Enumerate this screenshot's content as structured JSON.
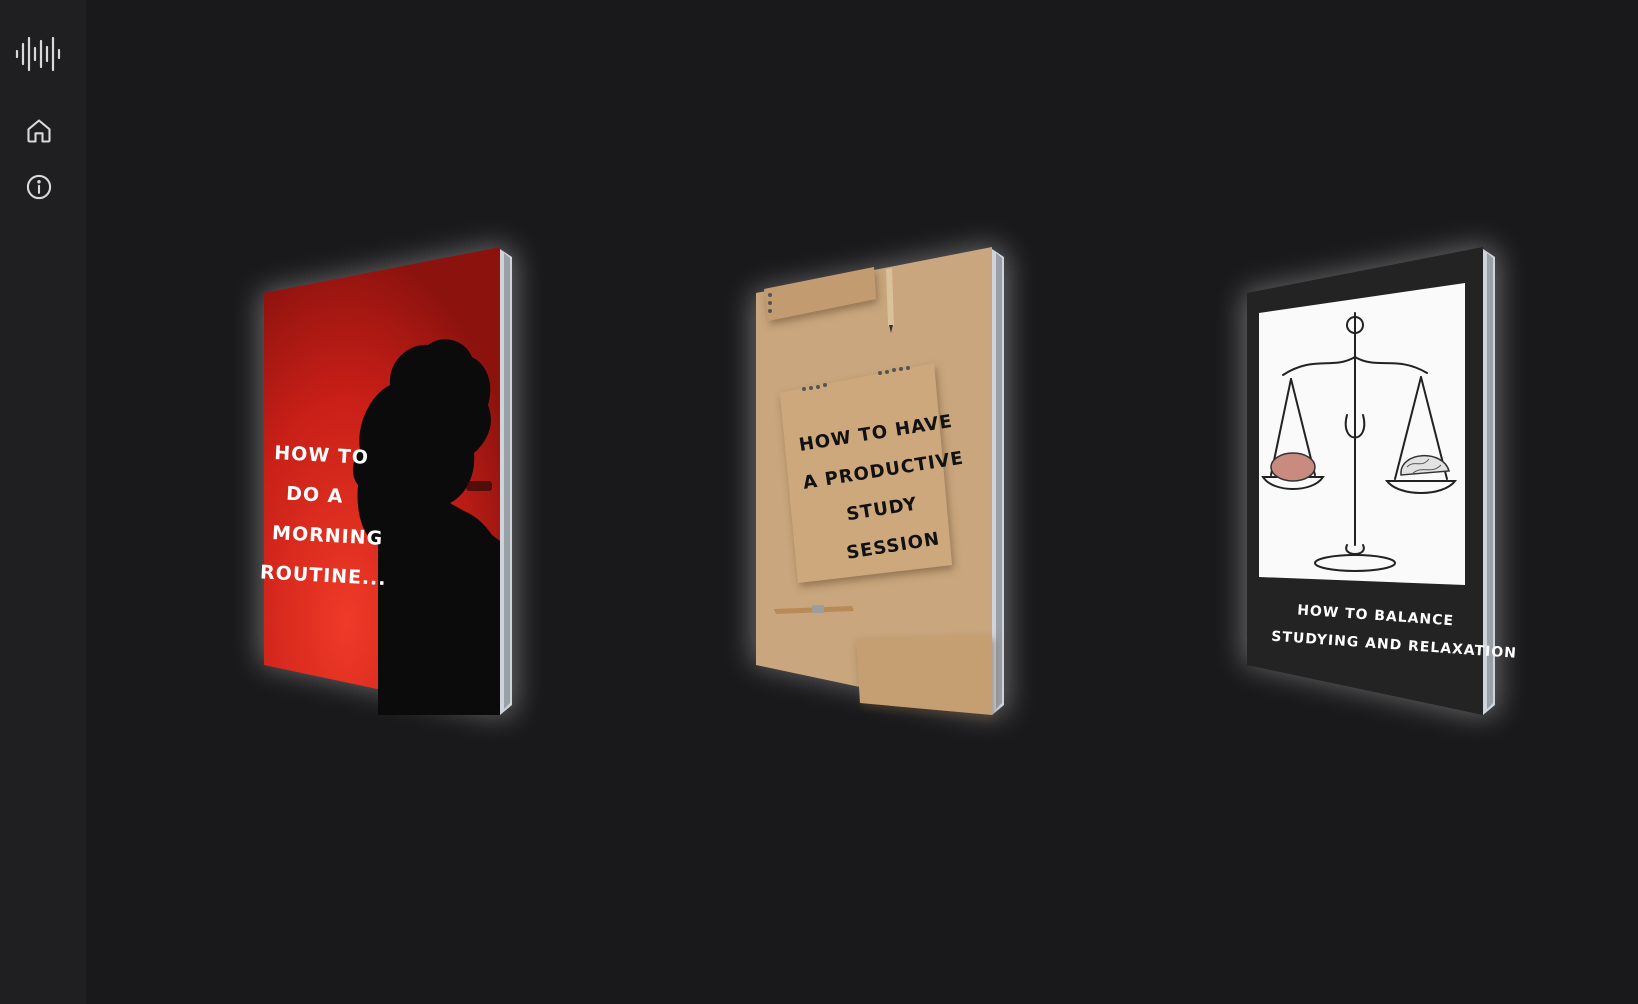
{
  "sidebar": {
    "logo_icon": "soundwave-logo-icon",
    "nav": [
      {
        "icon": "home-icon"
      },
      {
        "icon": "info-icon"
      }
    ]
  },
  "books": [
    {
      "cover_lines": [
        "HOW TO",
        "DO A",
        "MORNING",
        "ROUTINE..."
      ],
      "cover_color": "#d8221b"
    },
    {
      "cover_lines": [
        "HOW TO HAVE",
        "A PRODUCTIVE",
        "STUDY",
        "SESSION"
      ],
      "cover_color": "#c8a57c"
    },
    {
      "cover_lines": [
        "HOW TO BALANCE",
        "STUDYING AND RELAXATION"
      ],
      "cover_color": "#222222"
    }
  ],
  "colors": {
    "background": "#19191b",
    "sidebar": "#1f1f21",
    "icon": "#d9d9d9",
    "glow": "#ffffff"
  }
}
